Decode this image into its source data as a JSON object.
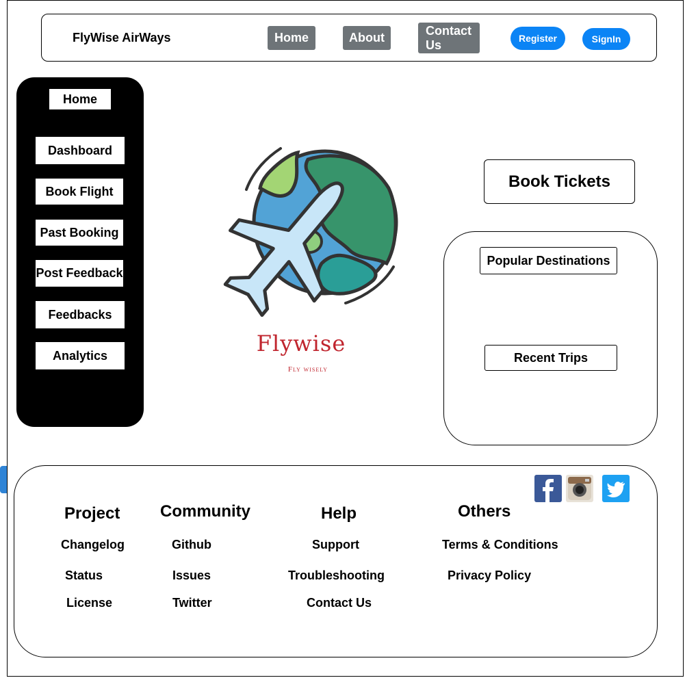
{
  "header": {
    "brand": "FlyWise AirWays",
    "nav": {
      "home": "Home",
      "about": "About",
      "contact": "Contact\nUs"
    },
    "register": "Register",
    "signin": "SignIn"
  },
  "sidebar": {
    "items": [
      "Home",
      "Dashboard",
      "Book Flight",
      "Past Booking",
      "Post Feedback",
      "Feedbacks",
      "Analytics"
    ]
  },
  "logo": {
    "wordmark": "Flywise",
    "tagline": "Fly wisely"
  },
  "main": {
    "book_tickets": "Book Tickets",
    "popular_destinations": "Popular Destinations",
    "recent_trips": "Recent Trips"
  },
  "footer": {
    "columns": [
      {
        "title": "Project",
        "links": [
          "Changelog",
          "Status",
          "License"
        ]
      },
      {
        "title": "Community",
        "links": [
          "Github",
          "Issues",
          "Twitter"
        ]
      },
      {
        "title": "Help",
        "links": [
          "Support",
          "Troubleshooting",
          "Contact Us"
        ]
      },
      {
        "title": "Others",
        "links": [
          "Terms & Conditions",
          "Privacy Policy"
        ]
      }
    ],
    "social": [
      "facebook-icon",
      "instagram-icon",
      "twitter-icon"
    ]
  },
  "colors": {
    "nav_gray": "#6e7478",
    "pill_blue": "#0b84f5",
    "brand_red": "#c0252e"
  }
}
